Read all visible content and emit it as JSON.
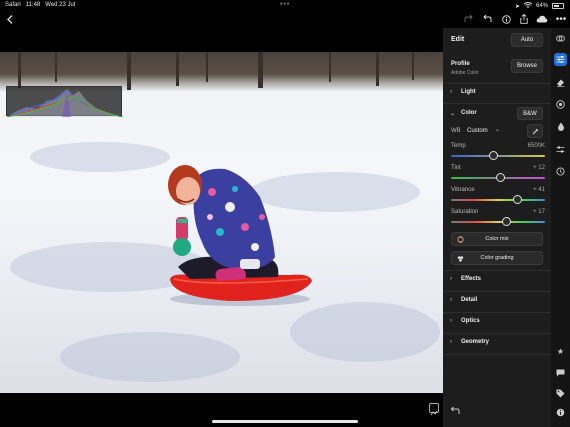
{
  "status": {
    "app": "Safari",
    "time": "11:48",
    "date": "Wed 23 Jul",
    "battery": "64%",
    "battery_level": 0.64
  },
  "edit": {
    "title": "Edit",
    "auto_label": "Auto",
    "profile_label": "Profile",
    "profile_value": "Adobe Color",
    "browse_label": "Browse"
  },
  "sections": {
    "light": "Light",
    "color": "Color",
    "bw": "B&W",
    "effects": "Effects",
    "detail": "Detail",
    "optics": "Optics",
    "geometry": "Geometry"
  },
  "color_panel": {
    "wb_label": "WB",
    "wb_value": "Custom",
    "sliders": [
      {
        "name": "Temp",
        "value": "6500K",
        "fraction": 0.45
      },
      {
        "name": "Tint",
        "value": "+ 12",
        "fraction": 0.52
      },
      {
        "name": "Vibrance",
        "value": "+ 41",
        "fraction": 0.7
      },
      {
        "name": "Saturation",
        "value": "+ 17",
        "fraction": 0.58
      }
    ],
    "color_mix_label": "Color mix",
    "color_grading_label": "Color grading"
  },
  "colors": {
    "accent": "#1f6fd6",
    "panel": "#1d1d1d",
    "sled": "#e0231c"
  }
}
